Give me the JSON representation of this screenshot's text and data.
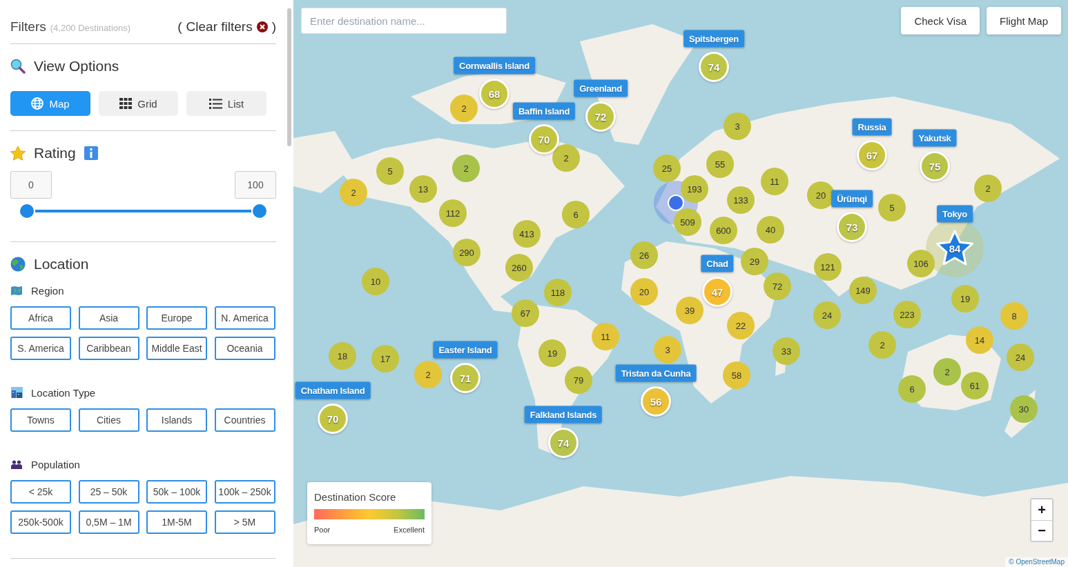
{
  "filters": {
    "title": "Filters",
    "count": "(4,200 Destinations)",
    "clear": {
      "open": "(",
      "label": "Clear filters",
      "close": ")"
    }
  },
  "view_options": {
    "title": "View Options",
    "buttons": [
      {
        "label": "Map",
        "selected": true
      },
      {
        "label": "Grid",
        "selected": false
      },
      {
        "label": "List",
        "selected": false
      }
    ]
  },
  "rating": {
    "title": "Rating",
    "min": "0",
    "max": "100",
    "thumbs": [
      {
        "level": 0
      },
      {
        "level": 1
      }
    ]
  },
  "location": {
    "title": "Location",
    "groups": [
      {
        "title": "Region",
        "options": [
          {
            "label": "Africa",
            "selected": false
          },
          {
            "label": "Asia",
            "selected": false
          },
          {
            "label": "Europe",
            "selected": false
          },
          {
            "label": "N. America",
            "selected": false
          },
          {
            "label": "S. America",
            "selected": false
          },
          {
            "label": "Caribbean",
            "selected": false
          },
          {
            "label": "Middle East",
            "selected": false
          },
          {
            "label": "Oceania",
            "selected": false
          }
        ]
      },
      {
        "title": "Location Type",
        "options": [
          {
            "label": "Towns",
            "selected": false
          },
          {
            "label": "Cities",
            "selected": false
          },
          {
            "label": "Islands",
            "selected": false
          },
          {
            "label": "Countries",
            "selected": false
          }
        ]
      },
      {
        "title": "Population",
        "options": [
          {
            "label": "< 25k",
            "selected": false
          },
          {
            "label": "25 – 50k",
            "selected": false
          },
          {
            "label": "50k – 100k",
            "selected": false
          },
          {
            "label": "100k – 250k",
            "selected": false
          },
          {
            "label": "250k-500k",
            "selected": false
          },
          {
            "label": "0,5M – 1M",
            "selected": false
          },
          {
            "label": "1M-5M",
            "selected": false
          },
          {
            "label": "> 5M",
            "selected": false
          }
        ]
      }
    ]
  },
  "map": {
    "search": {
      "placeholder": "Enter destination name..."
    },
    "buttons": [
      "Check Visa",
      "Flight Map"
    ],
    "clusters": [
      {
        "count": "2",
        "color": "#e3c53a"
      },
      {
        "count": "5",
        "color": "#c3c441"
      },
      {
        "count": "2",
        "color": "#e3c53a"
      },
      {
        "count": "13",
        "color": "#c3c441"
      },
      {
        "count": "2",
        "color": "#a9c24a"
      },
      {
        "count": "2",
        "color": "#c3c441"
      },
      {
        "count": "112",
        "color": "#c3c441"
      },
      {
        "count": "6",
        "color": "#c3c441"
      },
      {
        "count": "413",
        "color": "#c3c441"
      },
      {
        "count": "290",
        "color": "#c3c441"
      },
      {
        "count": "260",
        "color": "#c3c441"
      },
      {
        "count": "10",
        "color": "#c3c441"
      },
      {
        "count": "118",
        "color": "#c3c441"
      },
      {
        "count": "67",
        "color": "#c3c441"
      },
      {
        "count": "25",
        "color": "#c3c441"
      },
      {
        "count": "26",
        "color": "#c3c441"
      },
      {
        "count": "20",
        "color": "#e3c53a"
      },
      {
        "count": "11",
        "color": "#e3c53a"
      },
      {
        "count": "19",
        "color": "#c3c441"
      },
      {
        "count": "79",
        "color": "#c3c441"
      },
      {
        "count": "18",
        "color": "#c3c441"
      },
      {
        "count": "17",
        "color": "#c3c441"
      },
      {
        "count": "2",
        "color": "#e3c53a"
      },
      {
        "count": "3",
        "color": "#e3c53a"
      },
      {
        "count": "3",
        "color": "#c3c441"
      },
      {
        "count": "55",
        "color": "#c3c441"
      },
      {
        "count": "193",
        "color": "#c3c441"
      },
      {
        "count": "509",
        "color": "#c3c441"
      },
      {
        "count": "133",
        "color": "#c3c441"
      },
      {
        "count": "11",
        "color": "#c3c441"
      },
      {
        "count": "600",
        "color": "#c3c441"
      },
      {
        "count": "40",
        "color": "#c3c441"
      },
      {
        "count": "29",
        "color": "#c3c441"
      },
      {
        "count": "20",
        "color": "#c3c441"
      },
      {
        "count": "5",
        "color": "#c3c441"
      },
      {
        "count": "2",
        "color": "#c3c441"
      },
      {
        "count": "106",
        "color": "#c3c441"
      },
      {
        "count": "121",
        "color": "#c3c441"
      },
      {
        "count": "39",
        "color": "#e3c53a"
      },
      {
        "count": "72",
        "color": "#c3c441"
      },
      {
        "count": "149",
        "color": "#c3c441"
      },
      {
        "count": "22",
        "color": "#e3c53a"
      },
      {
        "count": "33",
        "color": "#c3c441"
      },
      {
        "count": "58",
        "color": "#e3c53a"
      },
      {
        "count": "24",
        "color": "#c3c441"
      },
      {
        "count": "223",
        "color": "#c3c441"
      },
      {
        "count": "19",
        "color": "#c3c441"
      },
      {
        "count": "8",
        "color": "#e3c53a"
      },
      {
        "count": "2",
        "color": "#c3c441"
      },
      {
        "count": "14",
        "color": "#e3c53a"
      },
      {
        "count": "24",
        "color": "#c3c441"
      },
      {
        "count": "2",
        "color": "#a9c24a"
      },
      {
        "count": "61",
        "color": "#b5c445"
      },
      {
        "count": "6",
        "color": "#b5c445"
      },
      {
        "count": "30",
        "color": "#a9c24a"
      }
    ],
    "destinations": [
      {
        "name": "Spitsbergen",
        "score": "74",
        "kind": "circle",
        "color": "#bfc545"
      },
      {
        "name": "Cornwallis Island",
        "score": "68",
        "kind": "circle",
        "color": "#c6c53f"
      },
      {
        "name": "Greenland",
        "score": "72",
        "kind": "circle",
        "color": "#c1c544"
      },
      {
        "name": "Baffin Island",
        "score": "70",
        "kind": "circle",
        "color": "#c3c541"
      },
      {
        "name": "Russia",
        "score": "67",
        "kind": "circle",
        "color": "#c9c43c"
      },
      {
        "name": "Yakutsk",
        "score": "75",
        "kind": "circle",
        "color": "#b9c449"
      },
      {
        "name": "Ürümqi",
        "score": "73",
        "kind": "circle",
        "color": "#bcc547"
      },
      {
        "name": "Tokyo",
        "score": "84",
        "kind": "star",
        "color": "#1e7be0"
      },
      {
        "name": "Chad",
        "score": "47",
        "kind": "circle",
        "color": "#f6bd30"
      },
      {
        "name": "Easter Island",
        "score": "71",
        "kind": "circle",
        "color": "#c0c545"
      },
      {
        "name": "Tristan da Cunha",
        "score": "56",
        "kind": "circle",
        "color": "#ebc137"
      },
      {
        "name": "Chatham Island",
        "score": "70",
        "kind": "circle",
        "color": "#c3c541"
      },
      {
        "name": "Falkland Islands",
        "score": "74",
        "kind": "circle",
        "color": "#b8c44b"
      }
    ],
    "legend": {
      "title": "Destination Score",
      "low": "Poor",
      "high": "Excellent"
    },
    "zoom": [
      "+",
      "−"
    ],
    "attribution": "© OpenStreetMap"
  }
}
